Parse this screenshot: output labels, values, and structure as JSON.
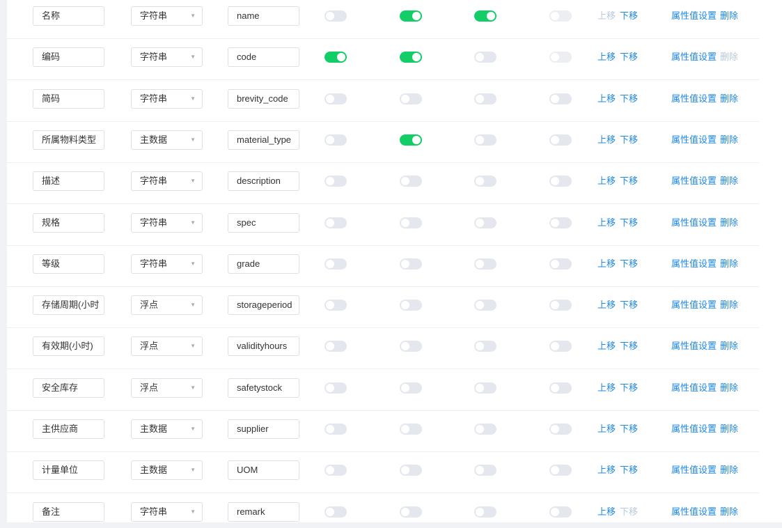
{
  "labels": {
    "move_up": "上移",
    "move_down": "下移",
    "attr_settings": "属性值设置",
    "delete": "删除"
  },
  "rows": [
    {
      "name": "名称",
      "type": "字符串",
      "field": "name",
      "switches": [
        false,
        true,
        true,
        false
      ],
      "switch_disabled": [
        false,
        false,
        false,
        true
      ],
      "up_disabled": true,
      "down_disabled": false,
      "delete_disabled": false
    },
    {
      "name": "编码",
      "type": "字符串",
      "field": "code",
      "switches": [
        true,
        true,
        false,
        false
      ],
      "switch_disabled": [
        false,
        false,
        false,
        true
      ],
      "up_disabled": false,
      "down_disabled": false,
      "delete_disabled": true
    },
    {
      "name": "简码",
      "type": "字符串",
      "field": "brevity_code",
      "switches": [
        false,
        false,
        false,
        false
      ],
      "switch_disabled": [
        false,
        false,
        false,
        false
      ],
      "up_disabled": false,
      "down_disabled": false,
      "delete_disabled": false
    },
    {
      "name": "所属物料类型",
      "type": "主数据",
      "field": "material_type",
      "switches": [
        false,
        true,
        false,
        false
      ],
      "switch_disabled": [
        false,
        false,
        false,
        false
      ],
      "up_disabled": false,
      "down_disabled": false,
      "delete_disabled": false
    },
    {
      "name": "描述",
      "type": "字符串",
      "field": "description",
      "switches": [
        false,
        false,
        false,
        false
      ],
      "switch_disabled": [
        false,
        false,
        false,
        false
      ],
      "up_disabled": false,
      "down_disabled": false,
      "delete_disabled": false
    },
    {
      "name": "规格",
      "type": "字符串",
      "field": "spec",
      "switches": [
        false,
        false,
        false,
        false
      ],
      "switch_disabled": [
        false,
        false,
        false,
        false
      ],
      "up_disabled": false,
      "down_disabled": false,
      "delete_disabled": false
    },
    {
      "name": "等级",
      "type": "字符串",
      "field": "grade",
      "switches": [
        false,
        false,
        false,
        false
      ],
      "switch_disabled": [
        false,
        false,
        false,
        false
      ],
      "up_disabled": false,
      "down_disabled": false,
      "delete_disabled": false
    },
    {
      "name": "存储周期(小时",
      "type": "浮点",
      "field": "storageperiod",
      "switches": [
        false,
        false,
        false,
        false
      ],
      "switch_disabled": [
        false,
        false,
        false,
        false
      ],
      "up_disabled": false,
      "down_disabled": false,
      "delete_disabled": false
    },
    {
      "name": "有效期(小时)",
      "type": "浮点",
      "field": "validityhours",
      "switches": [
        false,
        false,
        false,
        false
      ],
      "switch_disabled": [
        false,
        false,
        false,
        false
      ],
      "up_disabled": false,
      "down_disabled": false,
      "delete_disabled": false
    },
    {
      "name": "安全库存",
      "type": "浮点",
      "field": "safetystock",
      "switches": [
        false,
        false,
        false,
        false
      ],
      "switch_disabled": [
        false,
        false,
        false,
        false
      ],
      "up_disabled": false,
      "down_disabled": false,
      "delete_disabled": false
    },
    {
      "name": "主供应商",
      "type": "主数据",
      "field": "supplier",
      "switches": [
        false,
        false,
        false,
        false
      ],
      "switch_disabled": [
        false,
        false,
        false,
        false
      ],
      "up_disabled": false,
      "down_disabled": false,
      "delete_disabled": false
    },
    {
      "name": "计量单位",
      "type": "主数据",
      "field": "UOM",
      "switches": [
        false,
        false,
        false,
        false
      ],
      "switch_disabled": [
        false,
        false,
        false,
        false
      ],
      "up_disabled": false,
      "down_disabled": false,
      "delete_disabled": false
    },
    {
      "name": "备注",
      "type": "字符串",
      "field": "remark",
      "switches": [
        false,
        false,
        false,
        false
      ],
      "switch_disabled": [
        false,
        false,
        false,
        false
      ],
      "up_disabled": false,
      "down_disabled": true,
      "delete_disabled": false
    }
  ],
  "colors": {
    "switch_on": "#13ce66",
    "switch_off": "#e4e7ed",
    "link": "#1e88e5",
    "link_disabled": "#b8c9dc"
  }
}
